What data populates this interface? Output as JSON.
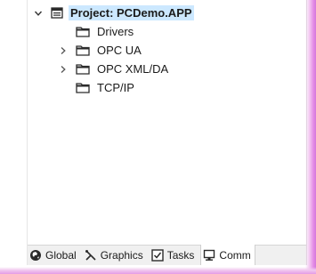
{
  "tree": {
    "root": {
      "label": "Project: PCDemo.APP",
      "expanded": true
    },
    "children": [
      {
        "label": "Drivers",
        "has_children": false
      },
      {
        "label": "OPC UA",
        "has_children": true
      },
      {
        "label": "OPC XML/DA",
        "has_children": true
      },
      {
        "label": "TCP/IP",
        "has_children": false
      }
    ]
  },
  "tabs": [
    {
      "label": "Global",
      "icon": "globe-icon",
      "active": false
    },
    {
      "label": "Graphics",
      "icon": "graphics-icon",
      "active": false
    },
    {
      "label": "Tasks",
      "icon": "tasks-icon",
      "active": false
    },
    {
      "label": "Comm",
      "icon": "comm-icon",
      "active": true
    }
  ],
  "colors": {
    "selection": "#cce8ff",
    "glow": "#e48ce6",
    "tab_bar": "#f0f0f0"
  }
}
